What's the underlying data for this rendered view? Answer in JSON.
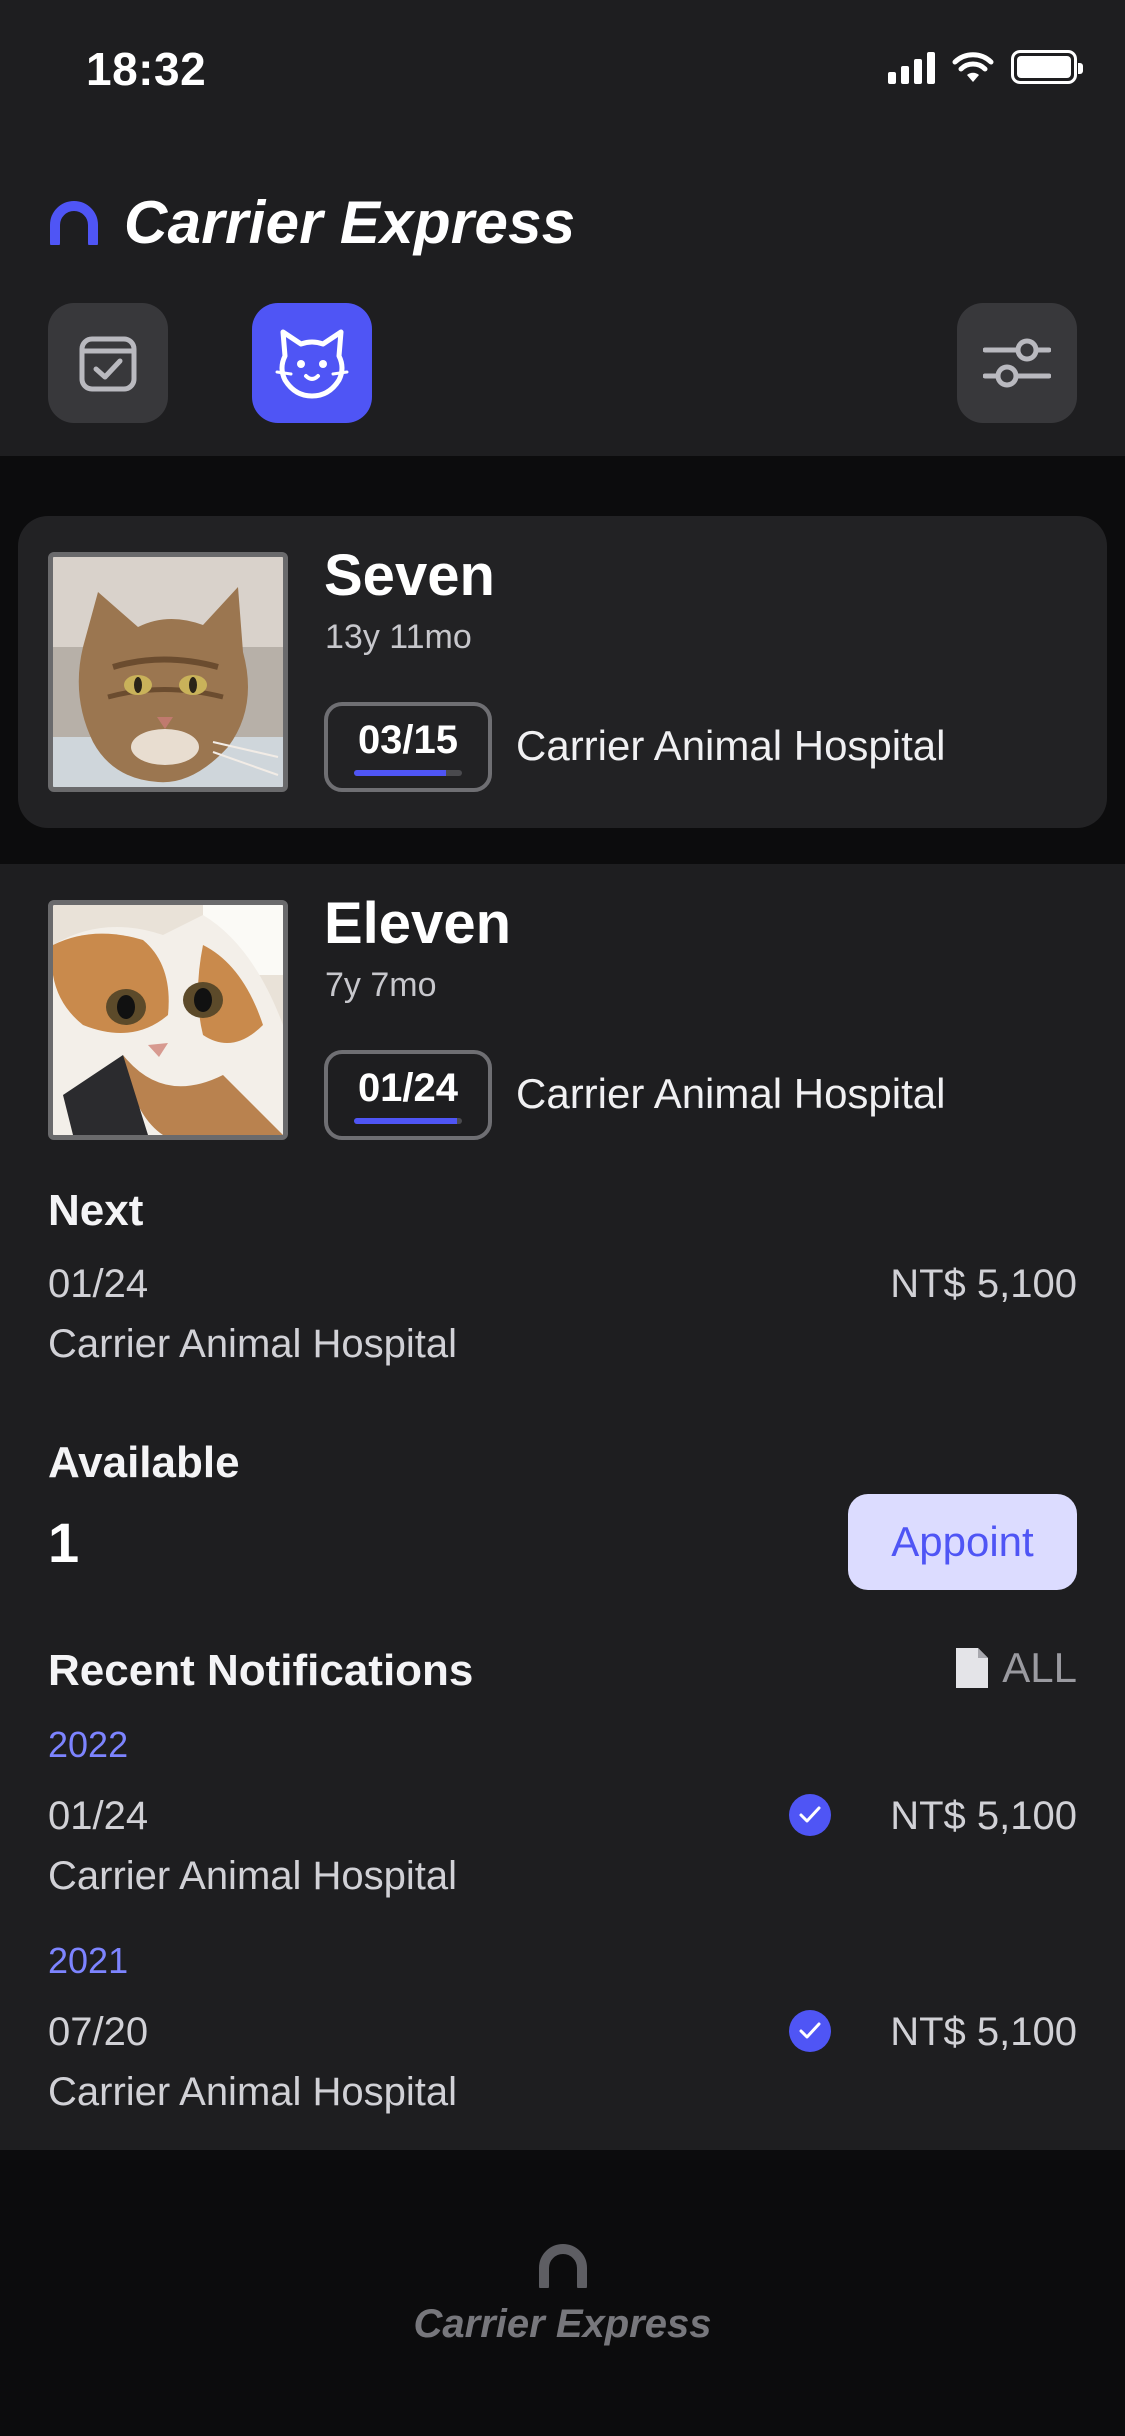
{
  "status_bar": {
    "time": "18:32"
  },
  "app": {
    "title": "Carrier Express",
    "accent": "#4f55f5"
  },
  "pets": [
    {
      "name": "Seven",
      "age": "13y 11mo",
      "badge_date": "03/15",
      "badge_progress": 0.85,
      "hospital": "Carrier Animal Hospital"
    },
    {
      "name": "Eleven",
      "age": "7y 7mo",
      "badge_date": "01/24",
      "badge_progress": 0.95,
      "hospital": "Carrier Animal Hospital"
    }
  ],
  "detail": {
    "next_label": "Next",
    "next_date": "01/24",
    "next_hospital": "Carrier Animal Hospital",
    "next_price": "NT$ 5,100",
    "available_label": "Available",
    "available_count": "1",
    "appoint_label": "Appoint"
  },
  "notifications": {
    "title": "Recent Notifications",
    "all_label": "ALL",
    "groups": [
      {
        "year": "2022",
        "date": "01/24",
        "hospital": "Carrier Animal Hospital",
        "price": "NT$ 5,100"
      },
      {
        "year": "2021",
        "date": "07/20",
        "hospital": "Carrier Animal Hospital",
        "price": "NT$ 5,100"
      }
    ]
  },
  "footer": {
    "brand": "Carrier Express"
  },
  "icons": {
    "status": [
      "signal-icon",
      "wifi-icon",
      "battery-icon"
    ],
    "toolbar": [
      "calendar-check-icon",
      "cat-icon",
      "sliders-icon"
    ]
  }
}
